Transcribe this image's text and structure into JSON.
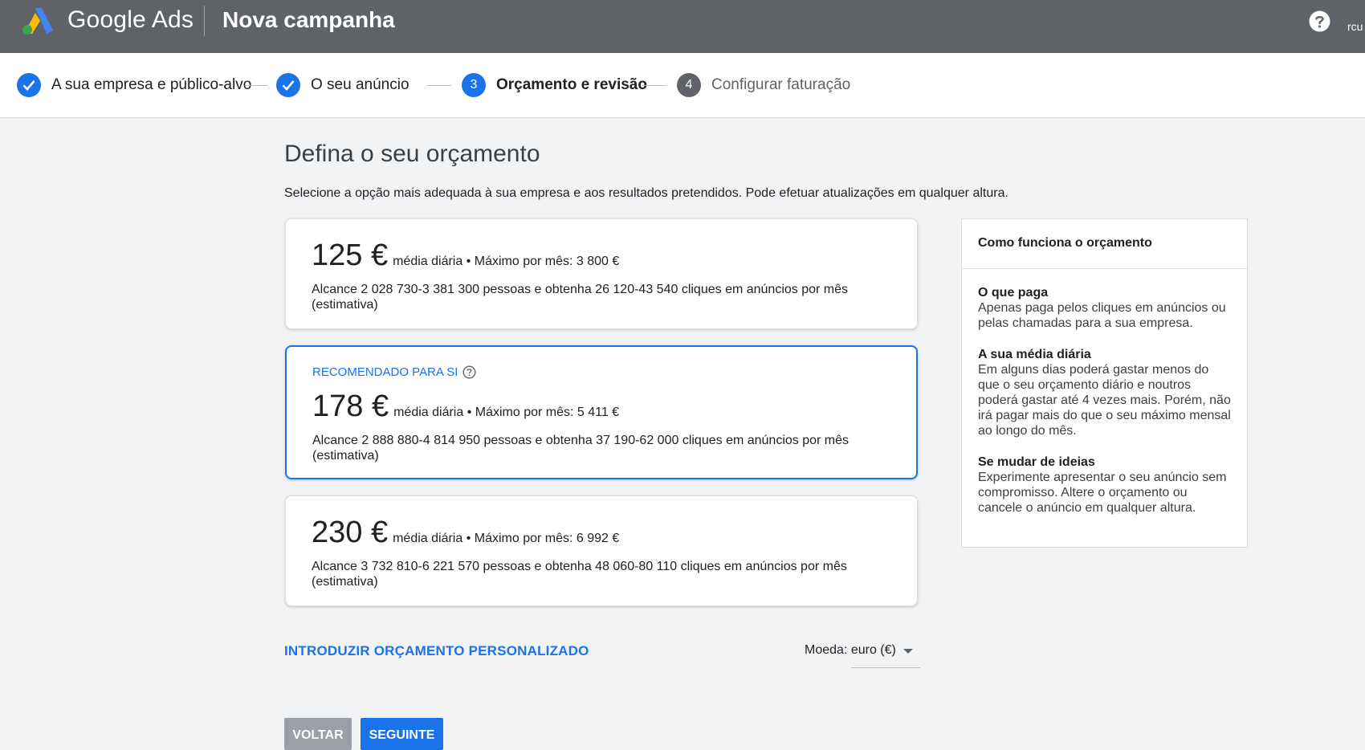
{
  "header": {
    "brand": "Google Ads",
    "campaign_title": "Nova campanha",
    "user_text": "rcu",
    "help_icon": "help-circle-icon",
    "logo_icon": "google-ads-logo"
  },
  "stepper": {
    "steps": [
      {
        "label": "A sua empresa e público-alvo",
        "state": "done",
        "marker": "check-icon"
      },
      {
        "label": "O seu anúncio",
        "state": "done",
        "marker": "check-icon"
      },
      {
        "label": "Orçamento e revisão",
        "state": "active",
        "number": "3"
      },
      {
        "label": "Configurar faturação",
        "state": "todo",
        "number": "4"
      }
    ]
  },
  "main": {
    "title": "Defina o seu orçamento",
    "subtitle": "Selecione a opção mais adequada à sua empresa e aos resultados pretendidos. Pode efetuar atualizações em qualquer altura.",
    "options": [
      {
        "price": "125 €",
        "detail": "média diária • Máximo por mês: 3 800 €",
        "reach": "Alcance 2 028 730-3 381 300 pessoas e obtenha 26 120-43 540 cliques em anúncios por mês (estimativa)",
        "selected": false
      },
      {
        "recommended": "RECOMENDADO PARA SI",
        "price": "178 €",
        "detail": "média diária • Máximo por mês: 5 411 €",
        "reach": "Alcance 2 888 880-4 814 950 pessoas e obtenha 37 190-62 000 cliques em anúncios por mês (estimativa)",
        "selected": true
      },
      {
        "price": "230 €",
        "detail": "média diária • Máximo por mês: 6 992 €",
        "reach": "Alcance 3 732 810-6 221 570 pessoas e obtenha 48 060-80 110 cliques em anúncios por mês (estimativa)",
        "selected": false
      }
    ],
    "custom_budget_link": "INTRODUZIR ORÇAMENTO PERSONALIZADO",
    "currency": "Moeda: euro (€)"
  },
  "info_panel": {
    "title": "Como funciona o orçamento",
    "sections": [
      {
        "heading": "O que paga",
        "text": "Apenas paga pelos cliques em anúncios ou pelas chamadas para a sua empresa."
      },
      {
        "heading": "A sua média diária",
        "text": "Em alguns dias poderá gastar menos do que o seu orçamento diário e noutros poderá gastar até 4 vezes mais. Porém, não irá pagar mais do que o seu máximo mensal ao longo do mês."
      },
      {
        "heading": "Se mudar de ideias",
        "text": "Experimente apresentar o seu anúncio sem compromisso. Altere o orçamento ou cancele o anúncio em qualquer altura."
      }
    ]
  },
  "footer": {
    "back_label": "VOLTAR",
    "next_label": "SEGUINTE"
  }
}
